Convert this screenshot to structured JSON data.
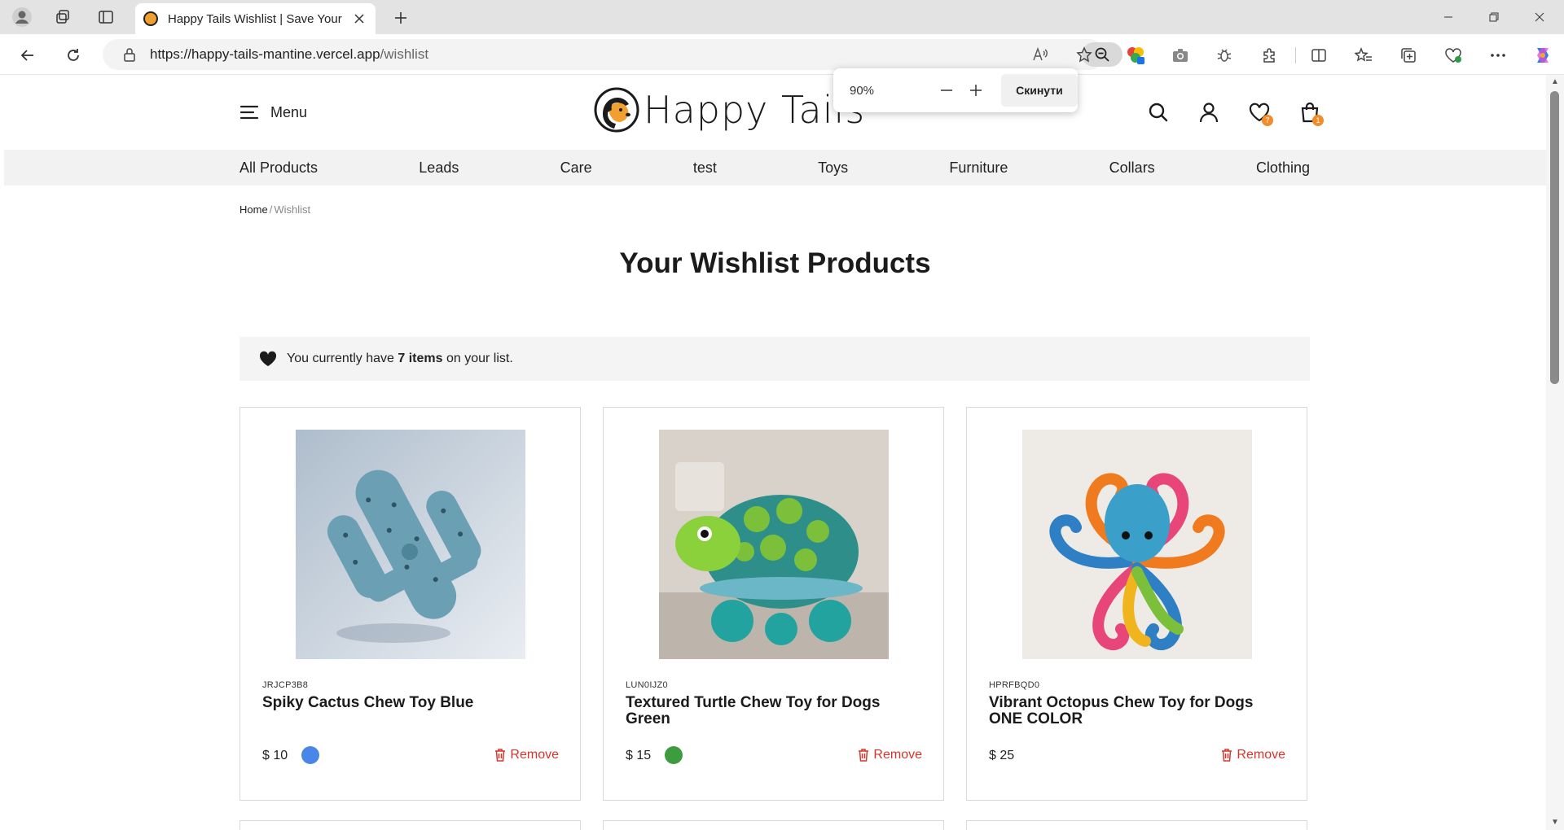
{
  "browser": {
    "tab_title": "Happy Tails Wishlist | Save Your Favorite Pet Products",
    "url_host": "https://happy-tails-mantine.vercel.app",
    "url_path": "/wishlist"
  },
  "zoom_popup": {
    "percent": "90%",
    "reset_label": "Скинути"
  },
  "header": {
    "menu_label": "Menu",
    "logo_text": "Happy Tails",
    "wishlist_count": "7",
    "cart_count": "1"
  },
  "categories": [
    "All Products",
    "Leads",
    "Care",
    "test",
    "Toys",
    "Furniture",
    "Collars",
    "Clothing"
  ],
  "breadcrumb": {
    "home": "Home",
    "separator": "/",
    "current": "Wishlist"
  },
  "page_title": "Your Wishlist Products",
  "notice": {
    "prefix": "You currently have ",
    "count_text": "7 items",
    "suffix": " on your list."
  },
  "products": [
    {
      "sku": "JRJCP3B8",
      "name": "Spiky Cactus Chew Toy Blue",
      "price": "$ 10",
      "swatch": "#4a86e8",
      "remove_label": "Remove"
    },
    {
      "sku": "LUN0IJZ0",
      "name": "Textured Turtle Chew Toy for Dogs Green",
      "price": "$ 15",
      "swatch": "#3d9c3f",
      "remove_label": "Remove"
    },
    {
      "sku": "HPRFBQD0",
      "name": "Vibrant Octopus Chew Toy for Dogs ONE COLOR",
      "price": "$ 25",
      "swatch": "",
      "remove_label": "Remove"
    }
  ],
  "colors": {
    "accent": "#f28c28",
    "remove": "#d9342b",
    "catbar_bg": "#f2f2f2"
  }
}
